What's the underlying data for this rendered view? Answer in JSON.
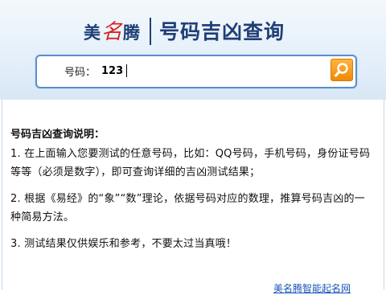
{
  "header": {
    "logo": {
      "part1": "美",
      "part2": "名",
      "part3": "腾"
    },
    "title": "号码吉凶查询"
  },
  "search": {
    "label": "号码：",
    "value": "123",
    "button_icon": "search-icon"
  },
  "instructions": {
    "title": "号码吉凶查询说明：",
    "items": [
      "1. 在上面输入您要测试的任意号码，比如：QQ号码，手机号码，身份证号码等等（必须是数字），即可查询详细的吉凶测试结果；",
      "2. 根据《易经》的“象”“数”理论，依据号码对应的数理，推算号码吉凶的一种简易方法。",
      "3. 测试结果仅供娱乐和参考，不要太过当真哦！"
    ]
  },
  "footer": {
    "link": "美名腾智能起名网"
  },
  "colors": {
    "brand_blue": "#1f3f75",
    "accent_red": "#d9241f",
    "button_orange": "#f08a0a"
  }
}
